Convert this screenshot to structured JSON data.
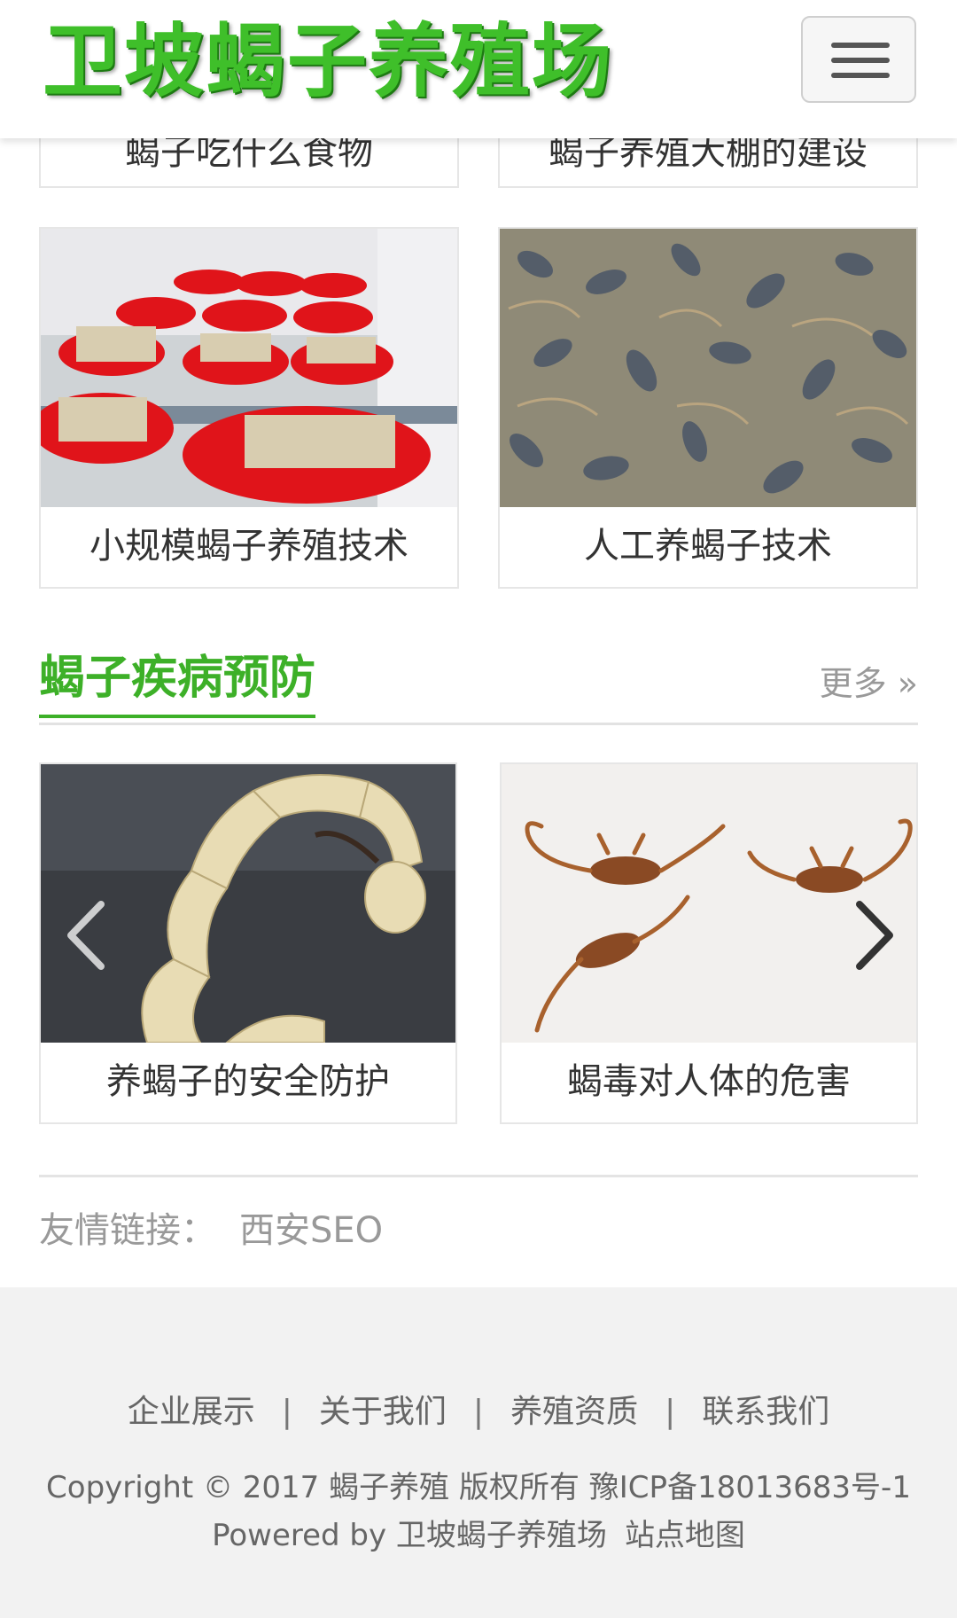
{
  "header": {
    "logo_text": "卫坡蝎子养殖场"
  },
  "top_row": {
    "items": [
      {
        "title": "蝎子吃什么食物"
      },
      {
        "title": "蝎子养殖大棚的建设"
      }
    ]
  },
  "row2": {
    "items": [
      {
        "title": "小规模蝎子养殖技术"
      },
      {
        "title": "人工养蝎子技术"
      }
    ]
  },
  "section": {
    "title": "蝎子疾病预防",
    "more": "更多 »"
  },
  "row3": {
    "items": [
      {
        "title": "养蝎子的安全防护"
      },
      {
        "title": "蝎毒对人体的危害"
      }
    ]
  },
  "links": {
    "label": "友情链接：",
    "items": [
      "西安SEO"
    ]
  },
  "footer": {
    "nav": [
      "企业展示",
      "关于我们",
      "养殖资质",
      "联系我们"
    ],
    "separator": "|",
    "copyright": "Copyright © 2017 蝎子养殖 版权所有 豫ICP备18013683号-1",
    "powered": "Powered by 卫坡蝎子养殖场",
    "sitemap": "站点地图"
  },
  "colors": {
    "accent": "#3db028",
    "logo_green": "#3fbf2a",
    "footer_bg": "#f2f2f2"
  }
}
